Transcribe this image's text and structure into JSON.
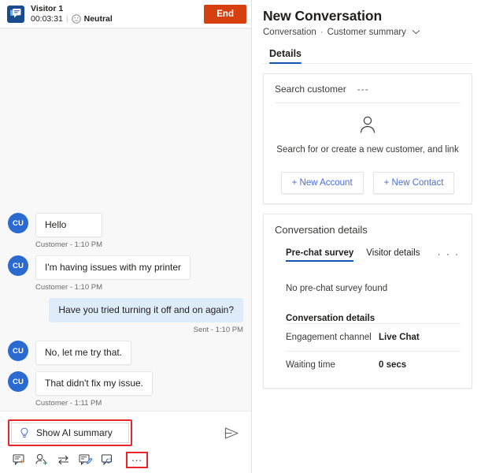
{
  "chat": {
    "header": {
      "channel_icon": "chat-bubbles-icon",
      "visitor_name": "Visitor 1",
      "duration": "00:03:31",
      "separator": "|",
      "sentiment_icon": "neutral-face-icon",
      "sentiment_label": "Neutral",
      "end_button": "End",
      "end_button_color": "#d6400f"
    },
    "messages": [
      {
        "id": "m1",
        "direction": "in",
        "avatar": "CU",
        "text": "Hello",
        "meta": "Customer - 1:10 PM"
      },
      {
        "id": "m2",
        "direction": "in",
        "avatar": "CU",
        "text": "I'm having issues with my printer",
        "meta": "Customer - 1:10 PM"
      },
      {
        "id": "m3",
        "direction": "out",
        "avatar": "",
        "text": "Have you tried turning it off and on again?",
        "meta": "Sent - 1:10 PM"
      },
      {
        "id": "m4",
        "direction": "in",
        "avatar": "CU",
        "text": "No, let me try that.",
        "meta": ""
      },
      {
        "id": "m5",
        "direction": "in",
        "avatar": "CU",
        "text": "That didn't fix my issue.",
        "meta": "Customer - 1:11 PM"
      }
    ],
    "composer": {
      "ai_summary_icon": "lightbulb-icon",
      "ai_summary_label": "Show AI summary",
      "ai_summary_highlight_color": "#e8262c",
      "send_icon": "send-arrow-icon"
    },
    "toolbar": {
      "items": [
        {
          "icon": "quick-replies-icon",
          "name": "quick-replies"
        },
        {
          "icon": "add-agent-icon",
          "name": "add-agent"
        },
        {
          "icon": "transfer-icon",
          "name": "transfer"
        },
        {
          "icon": "notes-icon",
          "name": "notes"
        },
        {
          "icon": "consult-icon",
          "name": "consult"
        }
      ],
      "more_label": "...",
      "more_highlight_color": "#e8262c"
    }
  },
  "details": {
    "title": "New Conversation",
    "breadcrumb": {
      "root": "Conversation",
      "dot": "·",
      "current": "Customer summary",
      "chevron": "chevron-down-icon"
    },
    "tabs": [
      {
        "label": "Details",
        "active": true
      }
    ],
    "customer_card": {
      "search_label": "Search customer",
      "search_value": "---",
      "person_icon": "person-outline-icon",
      "empty_text": "Search for or create a new customer, and link",
      "buttons": [
        {
          "label": "+ New Account"
        },
        {
          "label": "+ New Contact"
        }
      ]
    },
    "conversation_card": {
      "title": "Conversation details",
      "subtabs": [
        {
          "label": "Pre-chat survey",
          "active": true
        },
        {
          "label": "Visitor details",
          "active": false
        }
      ],
      "subtabs_more": "· · ·",
      "empty_text": "No pre-chat survey found",
      "section_title": "Conversation details",
      "fields": [
        {
          "key": "Engagement channel",
          "value": "Live Chat"
        },
        {
          "key": "Waiting time",
          "value": "0 secs"
        }
      ]
    }
  }
}
